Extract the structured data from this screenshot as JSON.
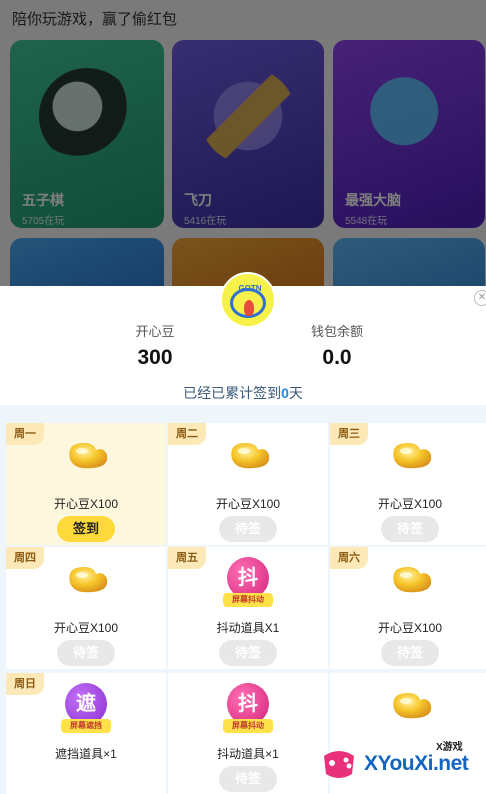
{
  "background": {
    "title": "陪你玩游戏，赢了偷红包",
    "games": [
      {
        "name": "五子棋",
        "players": "5705在玩"
      },
      {
        "name": "飞刀",
        "players": "5416在玩"
      },
      {
        "name": "最强大脑",
        "players": "5548在玩"
      }
    ]
  },
  "modal": {
    "stats": [
      {
        "label": "开心豆",
        "value": "300"
      },
      {
        "label": "钱包余额",
        "value": "0.0"
      }
    ],
    "signin": {
      "prefix": "已经已累计签到",
      "count": "0",
      "suffix": "天"
    },
    "days": [
      {
        "day": "周一",
        "reward": "开心豆X100",
        "button": "签到",
        "state": "active",
        "icon": "bean-icon"
      },
      {
        "day": "周二",
        "reward": "开心豆X100",
        "button": "待签",
        "state": "pending",
        "icon": "bean-icon"
      },
      {
        "day": "周三",
        "reward": "开心豆X100",
        "button": "待签",
        "state": "pending",
        "icon": "bean-icon"
      },
      {
        "day": "周四",
        "reward": "开心豆X100",
        "button": "待签",
        "state": "pending",
        "icon": "bean-icon"
      },
      {
        "day": "周五",
        "reward": "抖动道具X1",
        "button": "待签",
        "state": "pending",
        "icon": "shake-tool-icon",
        "glyph": "抖",
        "banner": "屏幕抖动"
      },
      {
        "day": "周六",
        "reward": "开心豆X100",
        "button": "待签",
        "state": "pending",
        "icon": "bean-icon"
      },
      {
        "day": "周日",
        "reward": "遮挡道具×1",
        "state": "pending",
        "icon": "block-tool-icon",
        "glyph": "遮",
        "banner": "屏幕遮挡"
      },
      {
        "day": "",
        "reward": "抖动道具×1",
        "button": "待签",
        "state": "pending",
        "icon": "shake-tool-icon",
        "glyph": "抖",
        "banner": "屏幕抖动"
      },
      {
        "day": "",
        "reward": "",
        "state": "pending",
        "icon": "bean-icon"
      }
    ]
  },
  "watermark": {
    "tag": "X游戏",
    "main": "XYouXi.net"
  },
  "colors": {
    "accent_yellow": "#ffd83a",
    "day_tag": "#fde9b8",
    "link_blue": "#1e88e5"
  }
}
